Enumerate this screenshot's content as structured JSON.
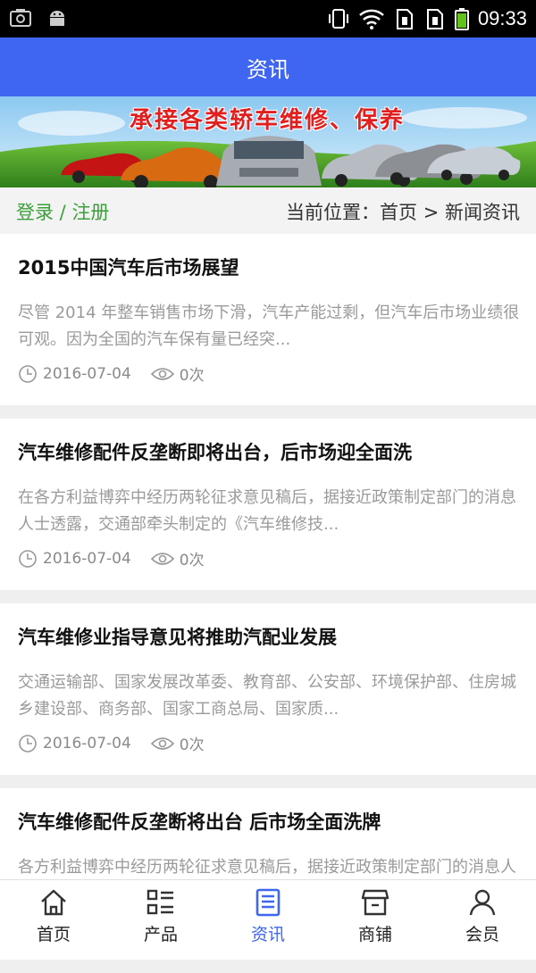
{
  "status_bar": {
    "time": "09:33"
  },
  "header": {
    "title": "资讯"
  },
  "banner": {
    "text": "承接各类轿车维修、保养"
  },
  "breadcrumb": {
    "login": "登录",
    "sep": " / ",
    "register": "注册",
    "position": "当前位置：首页 > 新闻资讯"
  },
  "news": [
    {
      "title": "2015中国汽车后市场展望",
      "desc": "尽管 2014 年整车销售市场下滑，汽车产能过剩，但汽车后市场业绩很可观。因为全国的汽车保有量已经突...",
      "date": "2016-07-04",
      "views": "0次"
    },
    {
      "title": "汽车维修配件反垄断即将出台，后市场迎全面洗",
      "desc": "在各方利益博弈中经历两轮征求意见稿后，据接近政策制定部门的消息人士透露，交通部牵头制定的《汽车维修技...",
      "date": "2016-07-04",
      "views": "0次"
    },
    {
      "title": "汽车维修业指导意见将推助汽配业发展",
      "desc": "交通运输部、国家发展改革委、教育部、公安部、环境保护部、住房城乡建设部、商务部、国家工商总局、国家质...",
      "date": "2016-07-04",
      "views": "0次"
    },
    {
      "title": "汽车维修配件反垄断将出台 后市场全面洗牌",
      "desc": "各方利益博弈中经历两轮征求意见稿后，据接近政策制定部门的消息人士透露",
      "date": "",
      "views": ""
    }
  ],
  "tabs": [
    {
      "label": "首页",
      "icon": "home-icon"
    },
    {
      "label": "产品",
      "icon": "grid-list-icon"
    },
    {
      "label": "资讯",
      "icon": "document-icon",
      "active": true
    },
    {
      "label": "商铺",
      "icon": "store-icon"
    },
    {
      "label": "会员",
      "icon": "user-icon"
    }
  ],
  "colors": {
    "accent": "#3f66f0",
    "login_green": "#3aa13a",
    "banner_red": "#e11f1f"
  }
}
